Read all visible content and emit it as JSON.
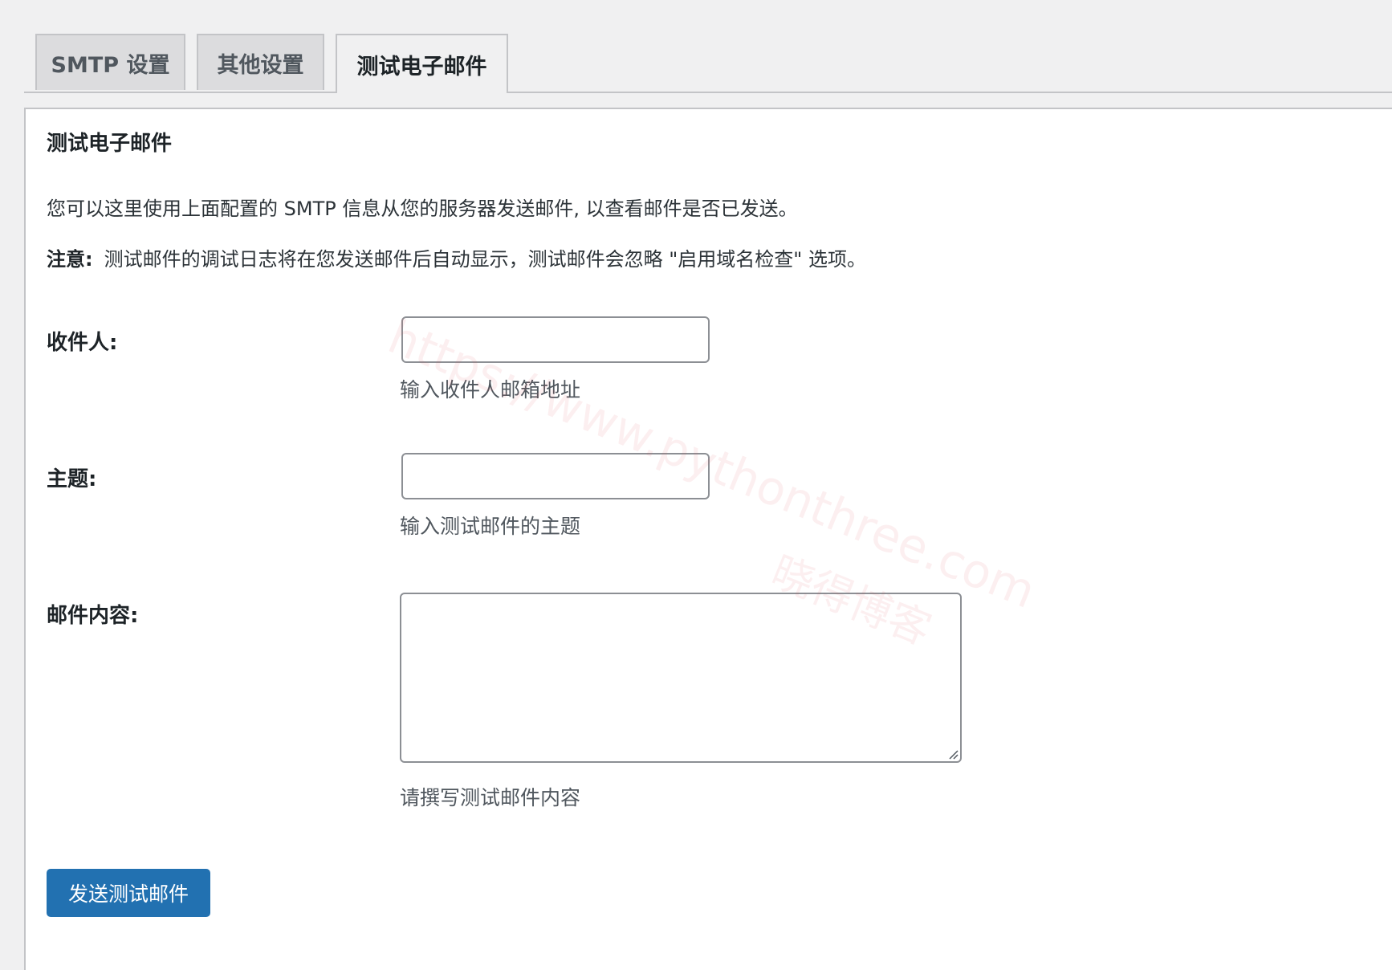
{
  "tabs": [
    {
      "label": "SMTP 设置"
    },
    {
      "label": "其他设置"
    },
    {
      "label": "测试电子邮件"
    }
  ],
  "panel": {
    "title": "测试电子邮件",
    "description": "您可以这里使用上面配置的 SMTP 信息从您的服务器发送邮件, 以查看邮件是否已发送。",
    "note_label": "注意:",
    "note_text": "测试邮件的调试日志将在您发送邮件后自动显示，测试邮件会忽略 \"启用域名检查\" 选项。"
  },
  "form": {
    "to": {
      "label": "收件人:",
      "value": "",
      "help": "输入收件人邮箱地址"
    },
    "subject": {
      "label": "主题:",
      "value": "",
      "help": "输入测试邮件的主题"
    },
    "message": {
      "label": "邮件内容:",
      "value": "",
      "help": "请撰写测试邮件内容"
    },
    "submit_label": "发送测试邮件"
  },
  "watermark": {
    "url": "https://www.pythonthree.com",
    "name": "晓得博客"
  },
  "colors": {
    "primary": "#2271b1",
    "border": "#c3c4c7",
    "background": "#f0f0f1"
  }
}
